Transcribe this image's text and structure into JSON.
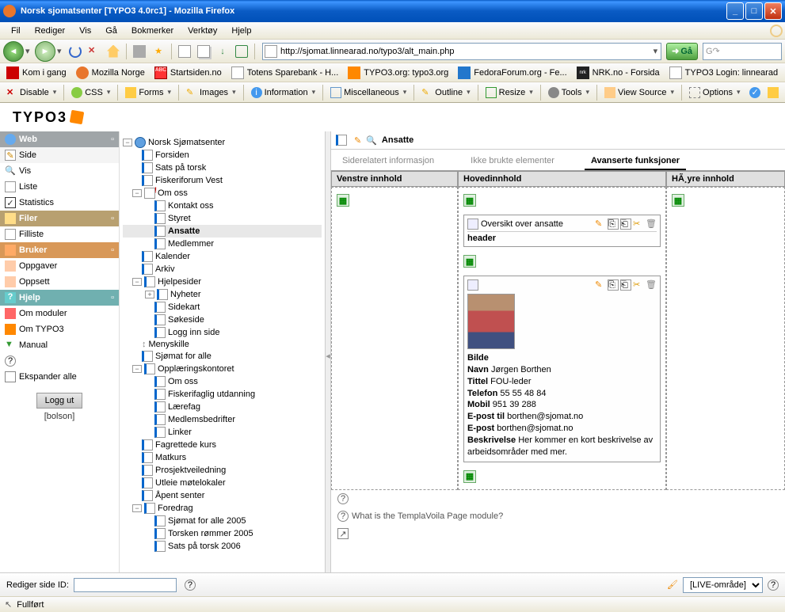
{
  "window": {
    "title": "Norsk sjomatsenter [TYPO3 4.0rc1] - Mozilla Firefox"
  },
  "menubar": [
    "Fil",
    "Rediger",
    "Vis",
    "Gå",
    "Bokmerker",
    "Verktøy",
    "Hjelp"
  ],
  "url": "http://sjomat.linnearad.no/typo3/alt_main.php",
  "go_label": "Gå",
  "bookmarks": [
    "Kom i gang",
    "Mozilla Norge",
    "Startsiden.no",
    "Totens Sparebank - H...",
    "TYPO3.org: typo3.org",
    "FedoraForum.org - Fe...",
    "NRK.no - Forsida",
    "TYPO3 Login: linnearad"
  ],
  "webdev": [
    "Disable",
    "CSS",
    "Forms",
    "Images",
    "Information",
    "Miscellaneous",
    "Outline",
    "Resize",
    "Tools",
    "View Source",
    "Options"
  ],
  "modules": {
    "web": {
      "title": "Web",
      "items": [
        "Side",
        "Vis",
        "Liste",
        "Statistics"
      ]
    },
    "filer": {
      "title": "Filer",
      "items": [
        "Filliste"
      ]
    },
    "bruker": {
      "title": "Bruker",
      "items": [
        "Oppgaver",
        "Oppsett"
      ]
    },
    "hjelp": {
      "title": "Hjelp",
      "items": [
        "Om moduler",
        "Om TYPO3",
        "Manual",
        "?"
      ]
    },
    "expand": "Ekspander alle",
    "logout": "Logg ut",
    "user": "[bolson]"
  },
  "tree": {
    "root": "Norsk Sjømatsenter",
    "items": [
      "Forsiden",
      "Sats på torsk",
      "Fiskeriforum Vest"
    ],
    "omoss": {
      "label": "Om oss",
      "children": [
        "Kontakt oss",
        "Styret",
        "Ansatte",
        "Medlemmer"
      ]
    },
    "after_omoss": [
      "Kalender",
      "Arkiv"
    ],
    "hjelpesider": {
      "label": "Hjelpesider",
      "children": [
        "Nyheter",
        "Sidekart",
        "Søkeside",
        "Logg inn side"
      ]
    },
    "menyskille": "Menyskille",
    "sjomat_alle": "Sjømat for alle",
    "opplaering": {
      "label": "Opplæringskontoret",
      "children": [
        "Om oss",
        "Fiskerifaglig utdanning",
        "Lærefag",
        "Medlemsbedrifter",
        "Linker"
      ]
    },
    "after_oppl": [
      "Fagrettede kurs",
      "Matkurs",
      "Prosjektveiledning",
      "Utleie møtelokaler",
      "Åpent senter"
    ],
    "foredrag": {
      "label": "Foredrag",
      "children": [
        "Sjømat for alle 2005",
        "Torsken rømmer 2005",
        "Sats på torsk 2006"
      ]
    }
  },
  "content": {
    "page_title": "Ansatte",
    "tabs": [
      "Siderelatert informasjon",
      "Ikke brukte elementer",
      "Avanserte funksjoner"
    ],
    "cols": {
      "left": "Venstre innhold",
      "main": "Hovedinnhold",
      "right": "HÃ¸yre innhold"
    },
    "ce1": {
      "title": "Oversikt over ansatte",
      "sub": "header"
    },
    "ce2": {
      "bilde": "Bilde",
      "navn_l": "Navn",
      "navn_v": "Jørgen Borthen",
      "tittel_l": "Tittel",
      "tittel_v": "FOU-leder",
      "tel_l": "Telefon",
      "tel_v": "55 55 48 84",
      "mob_l": "Mobil",
      "mob_v": "951 39 288",
      "eptil_l": "E-post til",
      "eptil_v": "borthen@sjomat.no",
      "ep_l": "E-post",
      "ep_v": "borthen@sjomat.no",
      "besk_l": "Beskrivelse",
      "besk_v": "Her kommer en kort beskrivelse av arbeidsområder med mer."
    },
    "help": "What is the TemplaVoila Page module?"
  },
  "bottom": {
    "label": "Rediger side ID:",
    "workspace": "[LIVE-område]"
  },
  "status": "Fullført"
}
